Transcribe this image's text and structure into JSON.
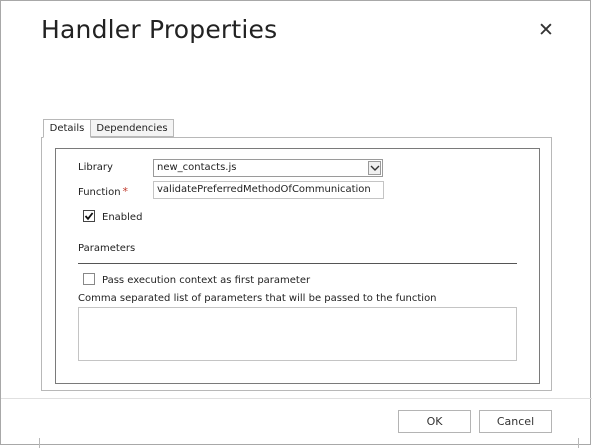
{
  "dialog": {
    "title": "Handler Properties",
    "close_glyph": "✕"
  },
  "tabs": [
    {
      "label": "Details",
      "active": true
    },
    {
      "label": "Dependencies",
      "active": false
    }
  ],
  "details": {
    "library_label": "Library",
    "library_value": "new_contacts.js",
    "function_label": "Function",
    "function_required_marker": "*",
    "function_value": "validatePreferredMethodOfCommunication",
    "enabled_label": "Enabled",
    "enabled_checked": true,
    "parameters_heading": "Parameters",
    "pass_context_label": "Pass execution context as first parameter",
    "pass_context_checked": false,
    "params_list_label": "Comma separated list of parameters that will be passed to the function",
    "params_list_value": ""
  },
  "footer": {
    "ok_label": "OK",
    "cancel_label": "Cancel"
  },
  "colors": {
    "required": "#c0392b",
    "border": "#b8b8b8"
  }
}
